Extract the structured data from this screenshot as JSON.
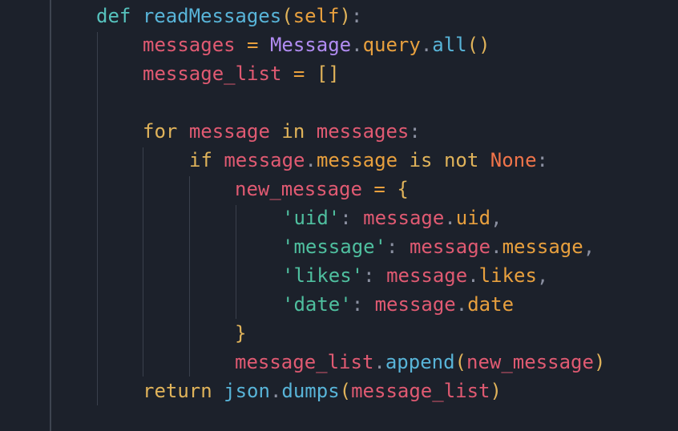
{
  "editor": {
    "language": "python",
    "theme_colors": {
      "background": "#1c212b",
      "keyword": "#e0b35a",
      "def_keyword": "#56c2bd",
      "function": "#58b4d8",
      "class": "#b18cf2",
      "variable": "#e05a72",
      "attribute": "#e8a03e",
      "string": "#4fbf9f",
      "constant": "#f0744a",
      "punctuation": "#8a8fa0"
    },
    "lines": [
      {
        "tokens": [
          {
            "t": "def",
            "c": "kwdef"
          },
          {
            "t": " ",
            "c": "punc"
          },
          {
            "t": "readMessages",
            "c": "fn"
          },
          {
            "t": "(",
            "c": "brk"
          },
          {
            "t": "self",
            "c": "attr"
          },
          {
            "t": ")",
            "c": "brk"
          },
          {
            "t": ":",
            "c": "punc"
          }
        ]
      },
      {
        "tokens": [
          {
            "t": "messages",
            "c": "var"
          },
          {
            "t": " = ",
            "c": "op"
          },
          {
            "t": "Message",
            "c": "cls"
          },
          {
            "t": ".",
            "c": "punc"
          },
          {
            "t": "query",
            "c": "attr"
          },
          {
            "t": ".",
            "c": "punc"
          },
          {
            "t": "all",
            "c": "fn"
          },
          {
            "t": "()",
            "c": "brk"
          }
        ]
      },
      {
        "tokens": [
          {
            "t": "message_list",
            "c": "var"
          },
          {
            "t": " = ",
            "c": "op"
          },
          {
            "t": "[]",
            "c": "brk"
          }
        ]
      },
      {
        "tokens": []
      },
      {
        "tokens": [
          {
            "t": "for",
            "c": "kw"
          },
          {
            "t": " ",
            "c": "punc"
          },
          {
            "t": "message",
            "c": "var"
          },
          {
            "t": " ",
            "c": "punc"
          },
          {
            "t": "in",
            "c": "kw"
          },
          {
            "t": " ",
            "c": "punc"
          },
          {
            "t": "messages",
            "c": "var"
          },
          {
            "t": ":",
            "c": "punc"
          }
        ]
      },
      {
        "tokens": [
          {
            "t": "if",
            "c": "kw"
          },
          {
            "t": " ",
            "c": "punc"
          },
          {
            "t": "message",
            "c": "var"
          },
          {
            "t": ".",
            "c": "punc"
          },
          {
            "t": "message",
            "c": "attr"
          },
          {
            "t": " ",
            "c": "punc"
          },
          {
            "t": "is",
            "c": "kw"
          },
          {
            "t": " ",
            "c": "punc"
          },
          {
            "t": "not",
            "c": "kw"
          },
          {
            "t": " ",
            "c": "punc"
          },
          {
            "t": "None",
            "c": "const"
          },
          {
            "t": ":",
            "c": "punc"
          }
        ]
      },
      {
        "tokens": [
          {
            "t": "new_message",
            "c": "var"
          },
          {
            "t": " = ",
            "c": "op"
          },
          {
            "t": "{",
            "c": "brk"
          }
        ]
      },
      {
        "tokens": [
          {
            "t": "'uid'",
            "c": "str"
          },
          {
            "t": ": ",
            "c": "punc"
          },
          {
            "t": "message",
            "c": "var"
          },
          {
            "t": ".",
            "c": "punc"
          },
          {
            "t": "uid",
            "c": "attr"
          },
          {
            "t": ",",
            "c": "punc"
          }
        ]
      },
      {
        "tokens": [
          {
            "t": "'message'",
            "c": "str"
          },
          {
            "t": ": ",
            "c": "punc"
          },
          {
            "t": "message",
            "c": "var"
          },
          {
            "t": ".",
            "c": "punc"
          },
          {
            "t": "message",
            "c": "attr"
          },
          {
            "t": ",",
            "c": "punc"
          }
        ]
      },
      {
        "tokens": [
          {
            "t": "'likes'",
            "c": "str"
          },
          {
            "t": ": ",
            "c": "punc"
          },
          {
            "t": "message",
            "c": "var"
          },
          {
            "t": ".",
            "c": "punc"
          },
          {
            "t": "likes",
            "c": "attr"
          },
          {
            "t": ",",
            "c": "punc"
          }
        ]
      },
      {
        "tokens": [
          {
            "t": "'date'",
            "c": "str"
          },
          {
            "t": ": ",
            "c": "punc"
          },
          {
            "t": "message",
            "c": "var"
          },
          {
            "t": ".",
            "c": "punc"
          },
          {
            "t": "date",
            "c": "attr"
          }
        ]
      },
      {
        "tokens": [
          {
            "t": "}",
            "c": "brk"
          }
        ]
      },
      {
        "tokens": [
          {
            "t": "message_list",
            "c": "var"
          },
          {
            "t": ".",
            "c": "punc"
          },
          {
            "t": "append",
            "c": "fn"
          },
          {
            "t": "(",
            "c": "brk"
          },
          {
            "t": "new_message",
            "c": "var"
          },
          {
            "t": ")",
            "c": "brk"
          }
        ]
      },
      {
        "tokens": [
          {
            "t": "return",
            "c": "kw"
          },
          {
            "t": " ",
            "c": "punc"
          },
          {
            "t": "json",
            "c": "fn"
          },
          {
            "t": ".",
            "c": "punc"
          },
          {
            "t": "dumps",
            "c": "fn"
          },
          {
            "t": "(",
            "c": "brk"
          },
          {
            "t": "message_list",
            "c": "var"
          },
          {
            "t": ")",
            "c": "brk"
          }
        ]
      }
    ]
  }
}
